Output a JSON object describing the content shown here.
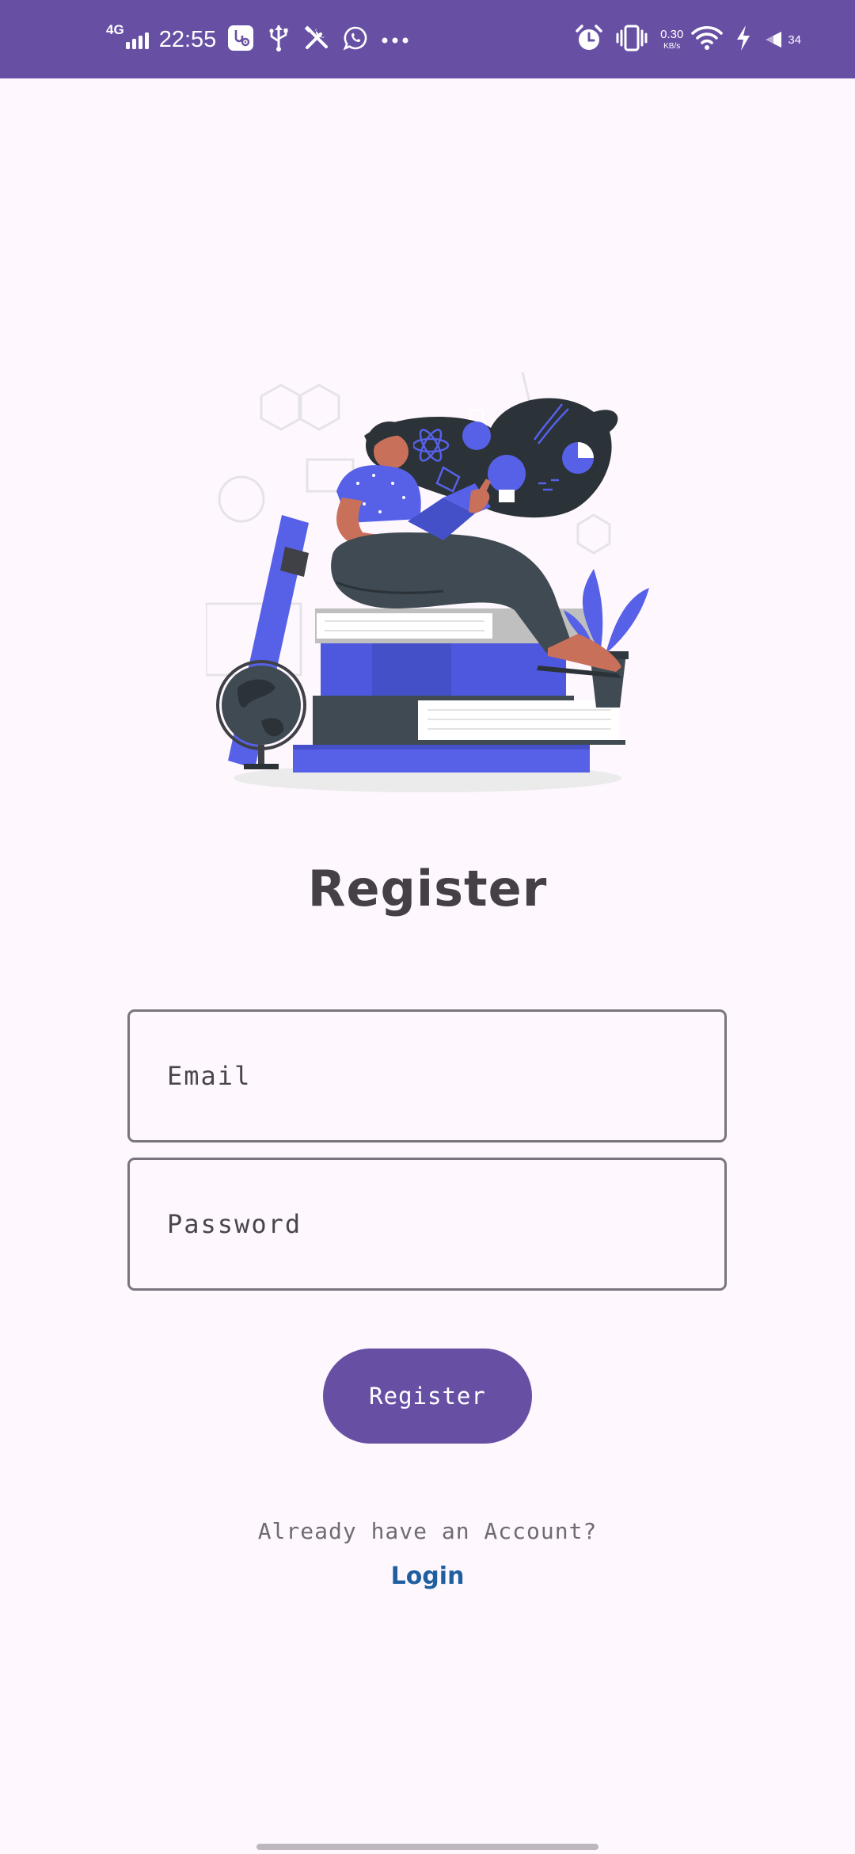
{
  "status_bar": {
    "network_type": "4G",
    "time": "22:55",
    "notification_icons": [
      "usb-settings-icon",
      "usb-icon",
      "tools-icon",
      "whatsapp-icon",
      "more-dots-icon"
    ],
    "speed_value": "0.30",
    "speed_unit": "KB/s",
    "battery_level": "34",
    "background_color": "#6750A4"
  },
  "illustration": {
    "description_icon": "girl-reading-on-books-illustration"
  },
  "form": {
    "title": "Register",
    "email_placeholder": "Email",
    "password_placeholder": "Password",
    "submit_label": "Register"
  },
  "footer": {
    "prompt": "Already have an Account?",
    "login_label": "Login"
  },
  "colors": {
    "primary": "#6750A4",
    "background": "#FEF7FE",
    "outline": "#79747E",
    "link": "#1F5FA0",
    "illustration_accent": "#5661E8"
  }
}
